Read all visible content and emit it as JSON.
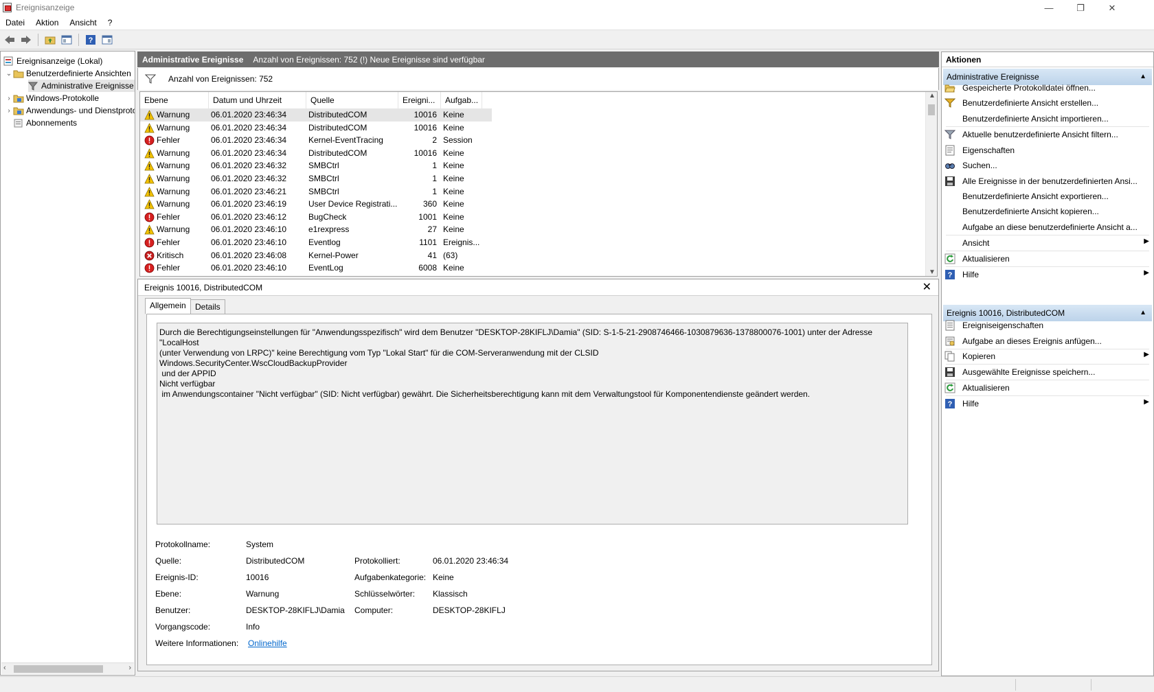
{
  "window": {
    "title": "Ereignisanzeige",
    "minimize": "—",
    "restore": "❐",
    "close": "✕"
  },
  "menu": [
    "Datei",
    "Aktion",
    "Ansicht",
    "?"
  ],
  "tree": {
    "root": "Ereignisanzeige (Lokal)",
    "custom_views": "Benutzerdefinierte Ansichten",
    "admin_events": "Administrative Ereignisse",
    "windows_logs": "Windows-Protokolle",
    "app_service_logs": "Anwendungs- und Dienstprotokolle",
    "subscriptions": "Abonnements"
  },
  "center": {
    "header_title": "Administrative Ereignisse",
    "header_info": "Anzahl von Ereignissen: 752 (!) Neue Ereignisse sind verfügbar",
    "filter_text": "Anzahl von Ereignissen: 752"
  },
  "list": {
    "columns": [
      "Ebene",
      "Datum und Uhrzeit",
      "Quelle",
      "Ereigni...",
      "Aufgab..."
    ],
    "rows": [
      {
        "level": "Warnung",
        "type": "warning",
        "date": "06.01.2020 23:46:34",
        "source": "DistributedCOM",
        "id": "10016",
        "task": "Keine"
      },
      {
        "level": "Warnung",
        "type": "warning",
        "date": "06.01.2020 23:46:34",
        "source": "DistributedCOM",
        "id": "10016",
        "task": "Keine"
      },
      {
        "level": "Fehler",
        "type": "error",
        "date": "06.01.2020 23:46:34",
        "source": "Kernel-EventTracing",
        "id": "2",
        "task": "Session"
      },
      {
        "level": "Warnung",
        "type": "warning",
        "date": "06.01.2020 23:46:34",
        "source": "DistributedCOM",
        "id": "10016",
        "task": "Keine"
      },
      {
        "level": "Warnung",
        "type": "warning",
        "date": "06.01.2020 23:46:32",
        "source": "SMBCtrl",
        "id": "1",
        "task": "Keine"
      },
      {
        "level": "Warnung",
        "type": "warning",
        "date": "06.01.2020 23:46:32",
        "source": "SMBCtrl",
        "id": "1",
        "task": "Keine"
      },
      {
        "level": "Warnung",
        "type": "warning",
        "date": "06.01.2020 23:46:21",
        "source": "SMBCtrl",
        "id": "1",
        "task": "Keine"
      },
      {
        "level": "Warnung",
        "type": "warning",
        "date": "06.01.2020 23:46:19",
        "source": "User Device Registrati...",
        "id": "360",
        "task": "Keine"
      },
      {
        "level": "Fehler",
        "type": "error",
        "date": "06.01.2020 23:46:12",
        "source": "BugCheck",
        "id": "1001",
        "task": "Keine"
      },
      {
        "level": "Warnung",
        "type": "warning",
        "date": "06.01.2020 23:46:10",
        "source": "e1rexpress",
        "id": "27",
        "task": "Keine"
      },
      {
        "level": "Fehler",
        "type": "error",
        "date": "06.01.2020 23:46:10",
        "source": "Eventlog",
        "id": "1101",
        "task": "Ereignis..."
      },
      {
        "level": "Kritisch",
        "type": "critical",
        "date": "06.01.2020 23:46:08",
        "source": "Kernel-Power",
        "id": "41",
        "task": "(63)"
      },
      {
        "level": "Fehler",
        "type": "error",
        "date": "06.01.2020 23:46:10",
        "source": "EventLog",
        "id": "6008",
        "task": "Keine"
      }
    ]
  },
  "detail": {
    "title": "Ereignis 10016, DistributedCOM",
    "close": "✕",
    "tabs": [
      "Allgemein",
      "Details"
    ],
    "description": "Durch die Berechtigungseinstellungen für \"Anwendungsspezifisch\" wird dem Benutzer \"DESKTOP-28KIFLJ\\Damia\" (SID: S-1-5-21-2908746466-1030879636-1378800076-1001) unter der Adresse \"LocalHost\n(unter Verwendung von LRPC)\" keine Berechtigung vom Typ \"Lokal Start\" für die COM-Serveranwendung mit der CLSID\nWindows.SecurityCenter.WscCloudBackupProvider\n und der APPID\nNicht verfügbar\n im Anwendungscontainer \"Nicht verfügbar\" (SID: Nicht verfügbar) gewährt. Die Sicherheitsberechtigung kann mit dem Verwaltungstool für Komponentendienste geändert werden.",
    "props": {
      "log_name_label": "Protokollname:",
      "log_name": "System",
      "source_label": "Quelle:",
      "source": "DistributedCOM",
      "logged_label": "Protokolliert:",
      "logged": "06.01.2020 23:46:34",
      "event_id_label": "Ereignis-ID:",
      "event_id": "10016",
      "task_cat_label": "Aufgabenkategorie:",
      "task_cat": "Keine",
      "level_label": "Ebene:",
      "level": "Warnung",
      "keywords_label": "Schlüsselwörter:",
      "keywords": "Klassisch",
      "user_label": "Benutzer:",
      "user": "DESKTOP-28KIFLJ\\Damia",
      "computer_label": "Computer:",
      "computer": "DESKTOP-28KIFLJ",
      "opcode_label": "Vorgangscode:",
      "opcode": "Info",
      "more_info_label": "Weitere Informationen:",
      "more_info_link": "Onlinehilfe"
    }
  },
  "actions": {
    "title": "Aktionen",
    "section1": "Administrative Ereignisse",
    "section1_items": [
      "Gespeicherte Protokolldatei öffnen...",
      "Benutzerdefinierte Ansicht erstellen...",
      "Benutzerdefinierte Ansicht importieren...",
      "Aktuelle benutzerdefinierte Ansicht filtern...",
      "Eigenschaften",
      "Suchen...",
      "Alle Ereignisse in der benutzerdefinierten Ansi...",
      "Benutzerdefinierte Ansicht exportieren...",
      "Benutzerdefinierte Ansicht kopieren...",
      "Aufgabe an diese benutzerdefinierte Ansicht a...",
      "Ansicht",
      "Aktualisieren",
      "Hilfe"
    ],
    "section2": "Ereignis 10016, DistributedCOM",
    "section2_items": [
      "Ereigniseigenschaften",
      "Aufgabe an dieses Ereignis anfügen...",
      "Kopieren",
      "Ausgewählte Ereignisse speichern...",
      "Aktualisieren",
      "Hilfe"
    ]
  },
  "colors": {
    "warning": "#f5c400",
    "error": "#d62020",
    "critical": "#c82020",
    "link": "#0066cc",
    "section_bg": "#c8dcf0"
  }
}
